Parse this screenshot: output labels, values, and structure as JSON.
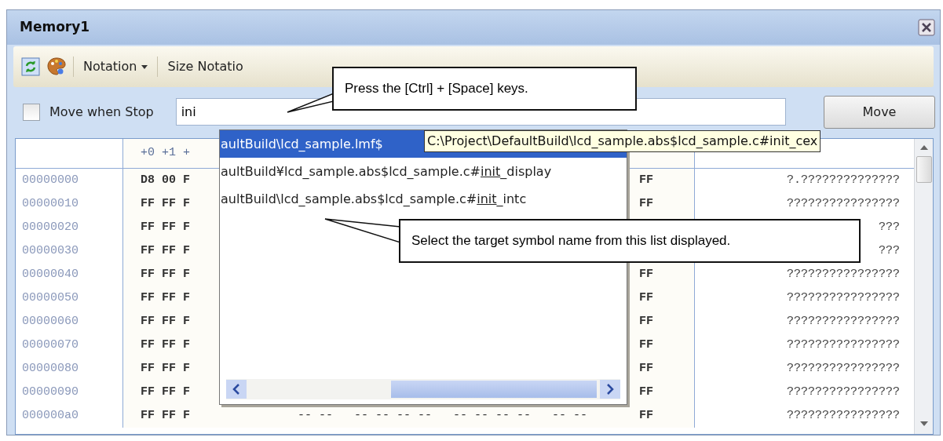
{
  "window": {
    "title": "Memory1"
  },
  "toolbar": {
    "menus": [
      {
        "label": "Notation",
        "caret": true
      },
      {
        "label": "Size Notatio",
        "caret": false
      }
    ]
  },
  "move_bar": {
    "checkbox": {
      "label": "Move when Stop",
      "checked": false
    },
    "field": {
      "value": "ini"
    },
    "button": "Move"
  },
  "grid": {
    "header": {
      "bytes": "+0 +1 +"
    },
    "rows": [
      {
        "address": "00000000",
        "left": "D8 00 F",
        "right": "FF",
        "ascii": "?.??????????????"
      },
      {
        "address": "00000010",
        "left": "FF FF F",
        "right": "FF",
        "ascii": "????????????????"
      },
      {
        "address": "00000020",
        "left": "FF FF F",
        "ascii": "???"
      },
      {
        "address": "00000030",
        "left": "FF FF F",
        "ascii": "???"
      },
      {
        "address": "00000040",
        "left": "FF FF F",
        "right": "FF",
        "ascii": "????????????????"
      },
      {
        "address": "00000050",
        "left": "FF FF F",
        "right": "FF",
        "ascii": "????????????????"
      },
      {
        "address": "00000060",
        "left": "FF FF F",
        "right": "FF",
        "ascii": "????????????????"
      },
      {
        "address": "00000070",
        "left": "FF FF F",
        "right": "FF",
        "ascii": "????????????????"
      },
      {
        "address": "00000080",
        "left": "FF FF F",
        "right": "FF",
        "ascii": "????????????????"
      },
      {
        "address": "00000090",
        "left": "FF FF F",
        "right": "FF",
        "ascii": "????????????????"
      },
      {
        "address": "000000a0",
        "left": "FF FF F",
        "middle": "-- --   -- -- -- --   -- -- -- --   -- --",
        "right": "FF",
        "ascii": "????????????????"
      }
    ]
  },
  "completion_list": {
    "items": [
      {
        "before": "aultBuild\\lcd_sample.lmf$",
        "selected": true
      },
      {
        "before": "aultBuild¥lcd_sample.abs$lcd_sample.c#",
        "match": "init",
        "after": "_display",
        "selected": false
      },
      {
        "before": "aultBuild\\lcd_sample.abs$lcd_sample.c#",
        "match": "init",
        "after": "_intc",
        "selected": false
      }
    ],
    "tooltip": "C:\\Project\\DefaultBuild\\lcd_sample.abs$lcd_sample.c#init_cex"
  },
  "callouts": [
    {
      "text": "Press the [Ctrl] + [Space] keys."
    },
    {
      "text": "Select the target symbol name from this list displayed."
    }
  ]
}
